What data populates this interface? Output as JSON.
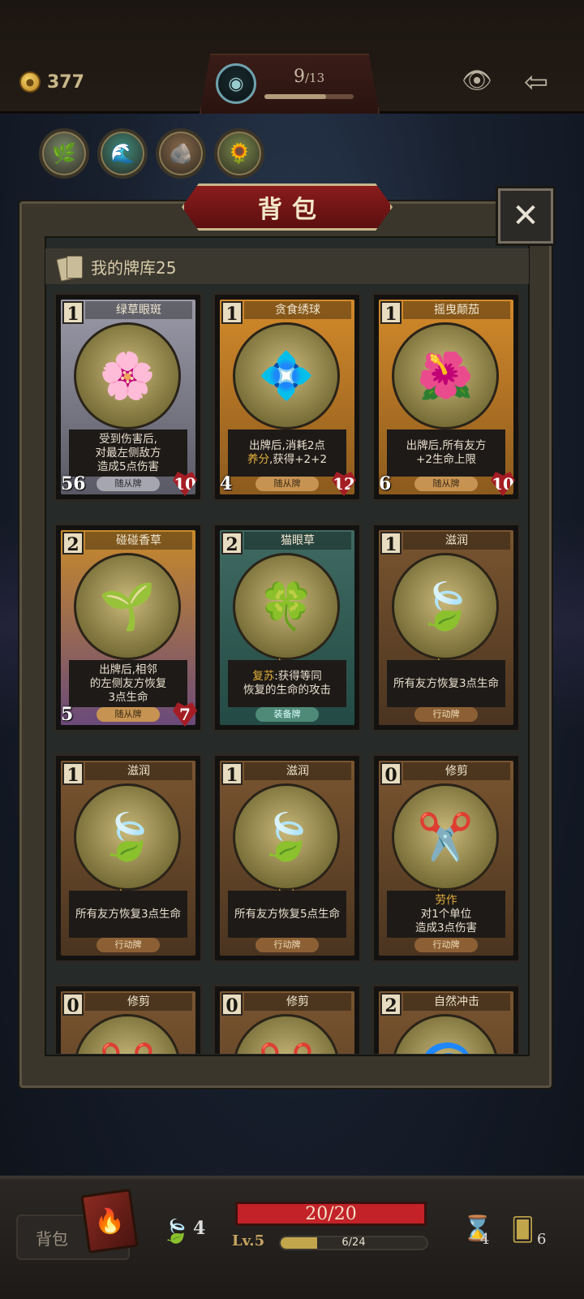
{
  "header": {
    "gold": "377",
    "progress_current": "9",
    "progress_total": "/13",
    "progress_fraction": 0.69,
    "icons": [
      "coin-icon",
      "portal-orb-icon",
      "eye-icon",
      "back-arrow-icon"
    ]
  },
  "relics": [
    {
      "emoji": "🌿",
      "bg": "#7c8a6a"
    },
    {
      "emoji": "🌊",
      "bg": "#3e8a7a"
    },
    {
      "emoji": "🪨",
      "bg": "#8a6a4a"
    },
    {
      "emoji": "🌻",
      "bg": "#7a8a4a"
    }
  ],
  "panel": {
    "title": "背包",
    "close": "✕",
    "deck_label": "我的牌库25"
  },
  "cards": [
    {
      "cost": "1",
      "name": "绿草眼斑",
      "kind": "minion grey",
      "art": "🌸",
      "desc": [
        "受到伤害后,",
        "对最左侧敌方",
        "造成5点伤害"
      ],
      "type": "随从牌",
      "atk": "56",
      "hp": "10",
      "stars": 0
    },
    {
      "cost": "1",
      "name": "贪食绣球",
      "kind": "minion",
      "art": "💠",
      "desc": [
        "出牌后,消耗2点",
        "<hl>养分</hl>,获得+2+2"
      ],
      "type": "随从牌",
      "atk": "4",
      "hp": "12",
      "stars": 0
    },
    {
      "cost": "1",
      "name": "摇曳颠茄",
      "kind": "minion",
      "art": "🌺",
      "desc": [
        "出牌后,所有友方",
        "+2生命上限"
      ],
      "type": "随从牌",
      "atk": "6",
      "hp": "10",
      "stars": 0
    },
    {
      "cost": "2",
      "name": "碰碰香草",
      "kind": "minion purple",
      "art": "🌱",
      "desc": [
        "出牌后,相邻",
        "的左侧友方恢复",
        "3点生命"
      ],
      "type": "随从牌",
      "atk": "5",
      "hp": "7",
      "stars": 0
    },
    {
      "cost": "2",
      "name": "猫眼草",
      "kind": "equip",
      "art": "🍀",
      "desc": [
        "<hl>复苏</hl>:获得等同",
        "恢复的生命的攻击"
      ],
      "type": "装备牌",
      "atk": "",
      "hp": "",
      "stars": 1
    },
    {
      "cost": "1",
      "name": "滋润",
      "kind": "action",
      "art": "🍃",
      "desc": [
        "所有友方恢复3点生命"
      ],
      "type": "行动牌",
      "atk": "",
      "hp": "",
      "stars": 1
    },
    {
      "cost": "1",
      "name": "滋润",
      "kind": "action",
      "art": "🍃",
      "desc": [
        "所有友方恢复3点生命"
      ],
      "type": "行动牌",
      "atk": "",
      "hp": "",
      "stars": 1
    },
    {
      "cost": "1",
      "name": "滋润",
      "kind": "action",
      "art": "🍃",
      "desc": [
        "所有友方恢复5点生命"
      ],
      "type": "行动牌",
      "atk": "",
      "hp": "",
      "stars": 2
    },
    {
      "cost": "0",
      "name": "修剪",
      "kind": "action",
      "art": "✂️",
      "desc": [
        "<hl>劳作</hl>",
        "对1个单位",
        "造成3点伤害"
      ],
      "type": "行动牌",
      "atk": "",
      "hp": "",
      "stars": 1
    },
    {
      "cost": "0",
      "name": "修剪",
      "kind": "action",
      "art": "✂️",
      "desc": [],
      "type": "",
      "atk": "",
      "hp": "",
      "stars": 0
    },
    {
      "cost": "0",
      "name": "修剪",
      "kind": "action",
      "art": "✂️",
      "desc": [],
      "type": "",
      "atk": "",
      "hp": "",
      "stars": 0
    },
    {
      "cost": "2",
      "name": "自然冲击",
      "kind": "action",
      "art": "🌀",
      "desc": [],
      "type": "",
      "atk": "",
      "hp": "",
      "stars": 0
    }
  ],
  "footer": {
    "bag_label": "背包",
    "leaf_count": "4",
    "hp_text": "20/20",
    "level": "Lv.5",
    "xp_text": "6/24",
    "xp_fraction": 0.25,
    "hourglass_count": "4",
    "deck_count": "6"
  }
}
